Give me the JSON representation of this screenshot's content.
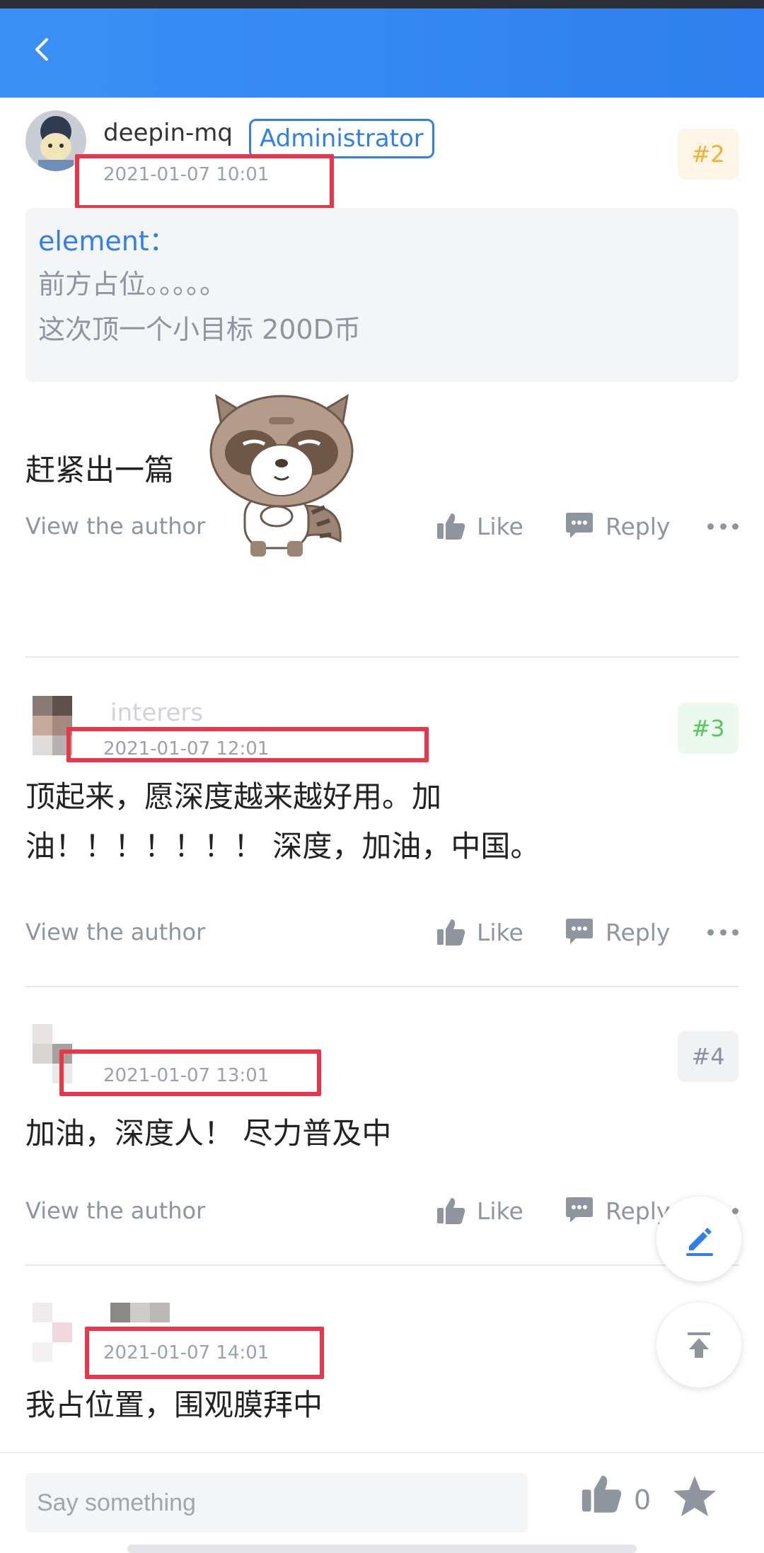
{
  "header": {
    "back_icon": "chevron-left-icon",
    "bg_color": "#2f7ff0"
  },
  "posts": [
    {
      "author": "deepin-mq",
      "role_badge": "Administrator",
      "time": "2021-01-07 10:01",
      "floor": "#2",
      "quote": {
        "user": "element：",
        "lines": [
          "前方占位。。。。。",
          "这次顶一个小目标 200D币"
        ]
      },
      "content": "赶紧出一篇",
      "sticker": "raccoon-sticker"
    },
    {
      "author": "interers",
      "time": "2021-01-07 12:01",
      "floor": "#3",
      "content_lines": [
        "顶起来，愿深度越来越好用。加",
        "油！！！！！！！ 深度，加油，中国。"
      ]
    },
    {
      "time": "2021-01-07 13:01",
      "floor": "#4",
      "content": "加油，深度人！ 尽力普及中"
    },
    {
      "time": "2021-01-07 14:01",
      "content": "我占位置，围观膜拜中"
    }
  ],
  "actions": {
    "view_author": "View the author",
    "like": "Like",
    "reply": "Reply"
  },
  "fabs": {
    "edit_icon": "pencil-icon",
    "top_icon": "back-to-top-icon"
  },
  "bottom_bar": {
    "input_placeholder": "Say something",
    "like_count": "0"
  },
  "colors": {
    "accent": "#2f7ff0",
    "highlight_box": "#e8374b"
  }
}
